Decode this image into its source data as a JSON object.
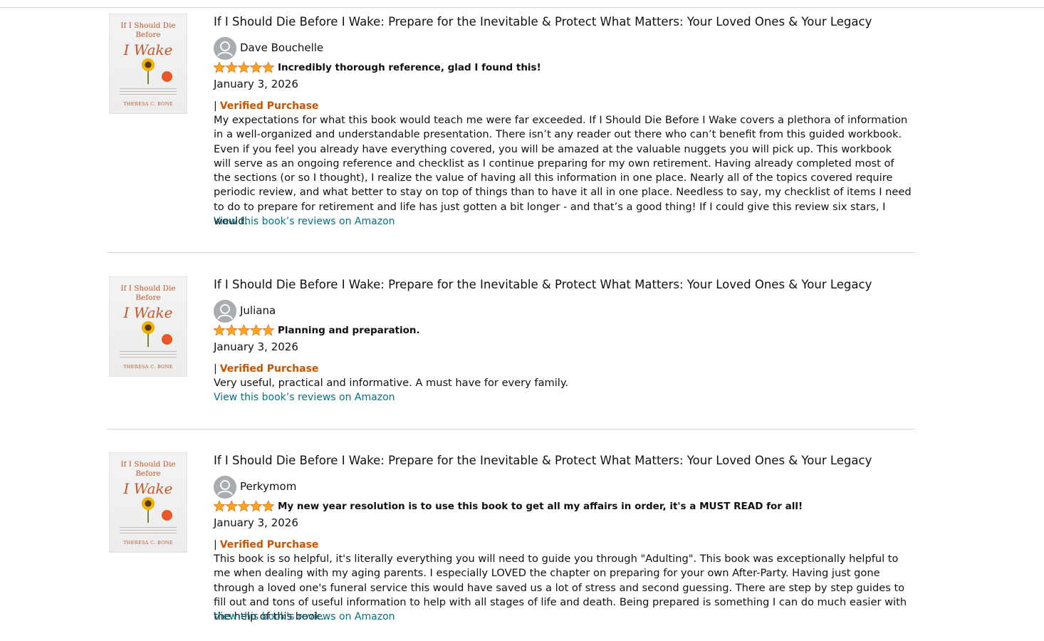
{
  "colors": {
    "accent_link": "#007185",
    "verified": "#c45500",
    "star": "#ffa41c",
    "divider": "#d5d9d9"
  },
  "icons": {
    "avatar": "default-user-avatar-icon",
    "star": "star-icon"
  },
  "reviews": [
    {
      "cover": {
        "title_line": "If I Should Die Before",
        "title_big": "I Wake",
        "author": "THERESA C. BONE"
      },
      "title": "If I Should Die Before I Wake: Prepare for the Inevitable & Protect What Matters: Your Loved Ones & Your Legacy",
      "reviewer": "Dave Bouchelle",
      "rating": 5,
      "headline": "Incredibly thorough reference, glad I found this!",
      "date": "January 3, 2026",
      "separator": "|",
      "verified": "Verified Purchase",
      "body": "My expectations for what this book would teach me were far exceeded. If I Should Die Before I Wake covers a plethora of information in a well-organized and understandable presentation. There isn’t any reader out there who can’t benefit from this guided workbook. Even if you feel you already have everything covered, you will be amazed at the valuable nuggets you will pick up. This workbook will serve as an ongoing reference and checklist as I continue preparing for my own retirement. Having already completed most of the sections (or so I thought), I realize the value of having all this information in one place. Nearly all of the topics covered require periodic review, and what better to stay on top of things than to have it all in one place. Needless to say, my checklist of items I need to do to prepare for retirement and life has just gotten a bit longer - and that’s a good thing! If I could give this review six stars, I would.",
      "link": "View this book’s reviews on Amazon"
    },
    {
      "cover": {
        "title_line": "If I Should Die Before",
        "title_big": "I Wake",
        "author": "THERESA C. BONE"
      },
      "title": "If I Should Die Before I Wake: Prepare for the Inevitable & Protect What Matters: Your Loved Ones & Your Legacy",
      "reviewer": "Juliana",
      "rating": 5,
      "headline": "Planning and preparation.",
      "date": "January 3, 2026",
      "separator": "|",
      "verified": "Verified Purchase",
      "body": "Very useful, practical and informative. A must have for every family.",
      "link": "View this book’s reviews on Amazon"
    },
    {
      "cover": {
        "title_line": "If I Should Die Before",
        "title_big": "I Wake",
        "author": "THERESA C. BONE"
      },
      "title": "If I Should Die Before I Wake: Prepare for the Inevitable & Protect What Matters: Your Loved Ones & Your Legacy",
      "reviewer": "Perkymom",
      "rating": 5,
      "headline": "My new year resolution is to use this book to get all my affairs in order, it's a MUST READ for all!",
      "date": "January 3, 2026",
      "separator": "|",
      "verified": "Verified Purchase",
      "body": "This book is so helpful, it's literally everything you will need to guide you through \"Adulting\". This book was exceptionally helpful to me when dealing with my aging parents. I especially LOVED the chapter on preparing for your own After-Party. Having just gone through a loved one's funeral service this would have saved us a lot of stress and second guessing. There are step by step guides to fill out and tons of useful information to help with all stages of life and death. Being prepared is something I can do much easier with the help of this book.",
      "link": "View this book’s reviews on Amazon"
    }
  ]
}
